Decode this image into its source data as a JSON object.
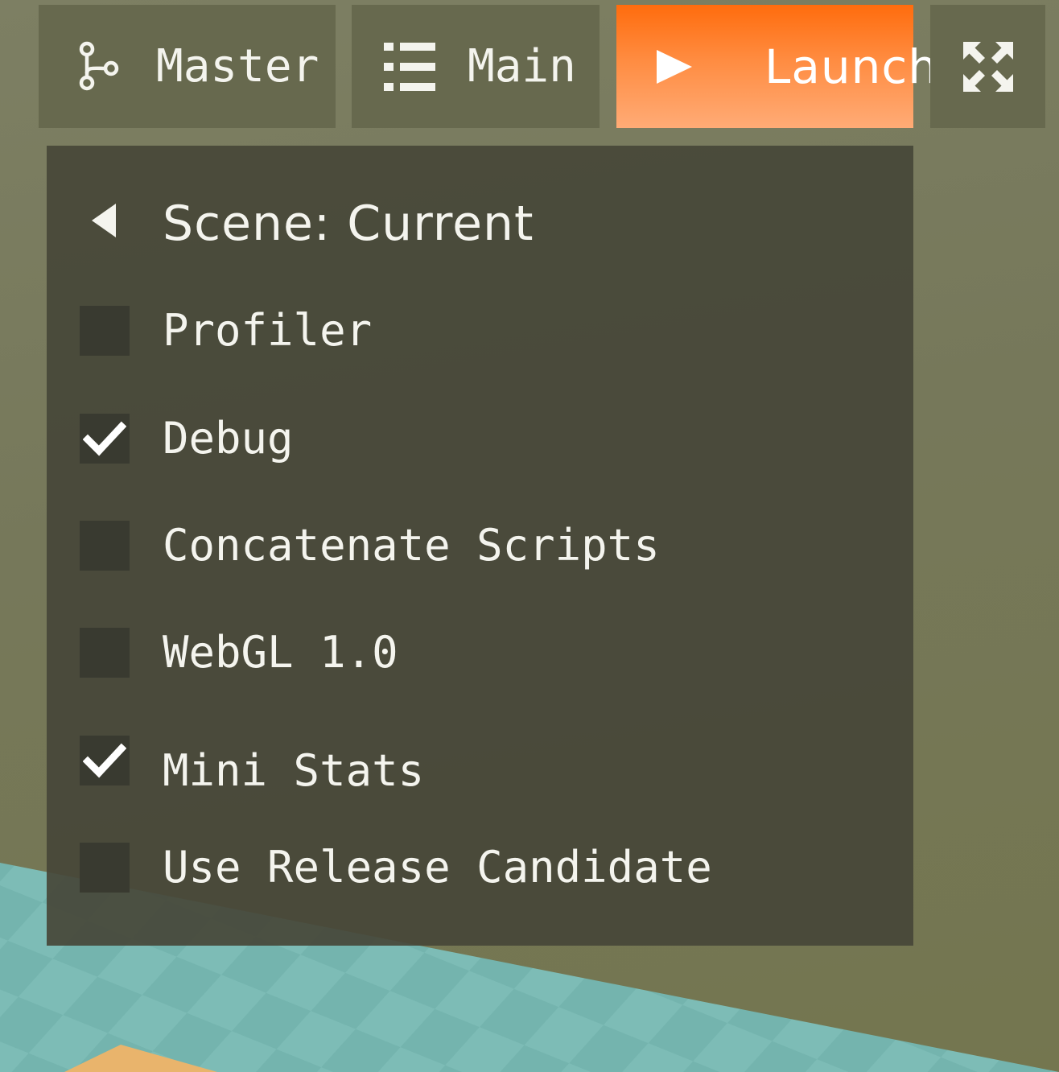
{
  "toolbar": {
    "master": {
      "label": "Master",
      "icon": "branch-icon"
    },
    "main": {
      "label": "Main",
      "icon": "list-icon"
    },
    "launch": {
      "label": "Launch",
      "icon": "play-icon"
    },
    "expand": {
      "icon": "expand-icon"
    }
  },
  "menu": {
    "scene_label": "Scene: Current",
    "options": [
      {
        "label": "Profiler",
        "checked": false
      },
      {
        "label": "Debug",
        "checked": true
      },
      {
        "label": "Concatenate Scripts",
        "checked": false
      },
      {
        "label": "WebGL 1.0",
        "checked": false
      },
      {
        "label": "Mini Stats",
        "checked": true
      },
      {
        "label": "Use Release Candidate",
        "checked": false
      }
    ]
  },
  "colors": {
    "accent": "#ff7b26",
    "toolbar_bg": "#67694e",
    "panel_bg": "#464638",
    "checkbox_bg": "#393a30",
    "text": "#f4f4ee"
  }
}
